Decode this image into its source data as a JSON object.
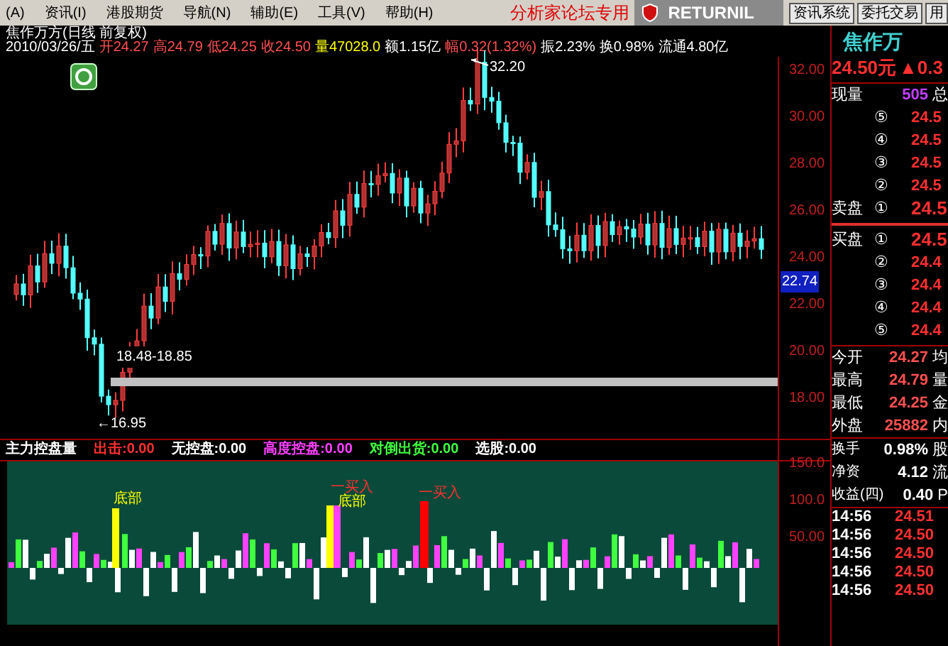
{
  "menu": [
    {
      "label": "(A)"
    },
    {
      "label": "资讯(I)"
    },
    {
      "label": "港股期货"
    },
    {
      "label": "导航(N)"
    },
    {
      "label": "辅助(E)"
    },
    {
      "label": "工具(V)"
    },
    {
      "label": "帮助(H)"
    }
  ],
  "forum_label": "分析家论坛专用",
  "brand": "RETURNIL",
  "top_buttons": [
    "资讯系统",
    "委托交易",
    "用"
  ],
  "chart_title": "焦作万方(日线 前复权)",
  "quote_line": [
    {
      "text": "2010/03/26/五",
      "color": "#ffffff"
    },
    {
      "text": "开24.27",
      "color": "#ff5050"
    },
    {
      "text": "高24.79",
      "color": "#ff5050"
    },
    {
      "text": "低24.25",
      "color": "#ff5050"
    },
    {
      "text": "收24.50",
      "color": "#ff5050"
    },
    {
      "text": "量47028.0",
      "color": "#ffff00"
    },
    {
      "text": "额1.15亿",
      "color": "#ffffff"
    },
    {
      "text": "幅0.32(1.32%)",
      "color": "#ff5050"
    },
    {
      "text": "振2.23%",
      "color": "#ffffff"
    },
    {
      "text": "换0.98%",
      "color": "#ffffff"
    },
    {
      "text": "流通4.80亿",
      "color": "#ffffff"
    }
  ],
  "price_axis": [
    "32.00",
    "30.00",
    "28.00",
    "26.00",
    "24.00",
    "22.00",
    "20.00",
    "18.00"
  ],
  "current_price_tag": "22.74",
  "annotations": {
    "high": "32.20",
    "range": "18.48-18.85",
    "low": "←16.95"
  },
  "indicator_axis": [
    "150.0",
    "100.0",
    "50.00"
  ],
  "indicator_header": [
    {
      "text": "主力控盘量",
      "color": "#ffffff"
    },
    {
      "text": "出击:0.00",
      "color": "#ff3030"
    },
    {
      "text": "无控盘:0.00",
      "color": "#ffffff"
    },
    {
      "text": "高度控盘:0.00",
      "color": "#ff40ff"
    },
    {
      "text": "对倒出货:0.00",
      "color": "#40ff40"
    },
    {
      "text": "选股:0.00",
      "color": "#ffffff"
    }
  ],
  "signals": [
    {
      "kind": "bottom",
      "label": "底部"
    },
    {
      "kind": "buy",
      "label": "一买入"
    },
    {
      "kind": "bottom",
      "label": "底部"
    },
    {
      "kind": "buy",
      "label": "一买入"
    }
  ],
  "stock_name": "焦作万",
  "last_price": "24.50元",
  "change": "▲0.3",
  "volume_now": {
    "label": "现量",
    "value": "505",
    "extra": "总"
  },
  "sell_orders": [
    {
      "mark": "⑤",
      "price": "24.5"
    },
    {
      "mark": "④",
      "price": "24.5"
    },
    {
      "mark": "③",
      "price": "24.5"
    },
    {
      "mark": "②",
      "price": "24.5"
    },
    {
      "mark": "①",
      "price": "24.5",
      "label": "卖盘"
    }
  ],
  "buy_orders": [
    {
      "mark": "①",
      "price": "24.5",
      "label": "买盘"
    },
    {
      "mark": "②",
      "price": "24.4"
    },
    {
      "mark": "③",
      "price": "24.4"
    },
    {
      "mark": "④",
      "price": "24.4"
    },
    {
      "mark": "⑤",
      "price": "24.4"
    }
  ],
  "stats": [
    {
      "label": "今开",
      "value": "24.27",
      "color": "#ff5050",
      "extra": "均"
    },
    {
      "label": "最高",
      "value": "24.79",
      "color": "#ff5050",
      "extra": "量"
    },
    {
      "label": "最低",
      "value": "24.25",
      "color": "#ff5050",
      "extra": "金"
    },
    {
      "label": "外盘",
      "value": "25882",
      "color": "#ff5050",
      "extra": "内"
    }
  ],
  "stats2": [
    {
      "label": "换手",
      "value": "0.98%",
      "extra": "股"
    },
    {
      "label": "净资",
      "value": "4.12",
      "extra": "流"
    },
    {
      "label": "收益(四)",
      "value": "0.40",
      "extra": "P"
    }
  ],
  "ticks": [
    {
      "time": "14:56",
      "price": "24.51"
    },
    {
      "time": "14:56",
      "price": "24.50"
    },
    {
      "time": "14:56",
      "price": "24.50"
    },
    {
      "time": "14:56",
      "price": "24.50"
    },
    {
      "time": "14:56",
      "price": "24.50"
    }
  ]
}
